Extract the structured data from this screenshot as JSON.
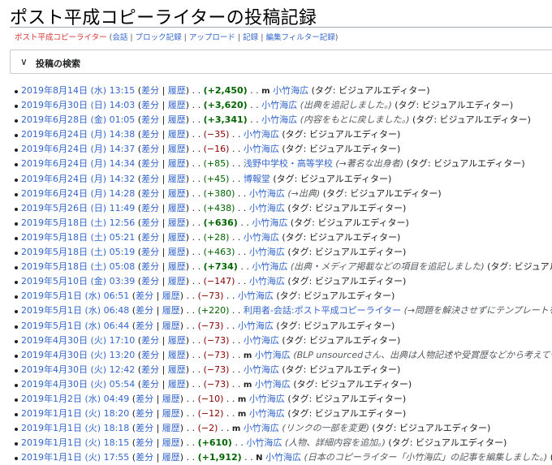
{
  "title": "ポスト平成コピーライターの投稿記録",
  "subtitle": {
    "user": "ポスト平成コピーライター",
    "links": [
      "会話",
      "ブロック記録",
      "アップロード",
      "記録",
      "編集フィルター記録"
    ]
  },
  "search": {
    "label": "投稿の検索",
    "chevron": "∨"
  },
  "labels": {
    "diff": "差分",
    "hist": "履歴",
    "tag_prefix": "タグ: ",
    "tag": "ビジュアルエディター"
  },
  "contribs": [
    {
      "date": "2019年8月14日 (水) 13:15",
      "size": "+2,450",
      "sizeClass": "posb",
      "flag": "m",
      "page": "小竹海広",
      "comment": "",
      "tag": "(タグ: ビジュアルエディター)"
    },
    {
      "date": "2019年6月30日 (日) 14:03",
      "size": "+3,620",
      "sizeClass": "posb",
      "flag": "",
      "page": "小竹海広",
      "comment": "(出典を追記しました。)",
      "tag": "(タグ: ビジュアルエディター)"
    },
    {
      "date": "2019年6月28日 (金) 01:05",
      "size": "+3,341",
      "sizeClass": "posb",
      "flag": "",
      "page": "小竹海広",
      "comment": "(内容をもとに戻しました。)",
      "tag": "(タグ: ビジュアルエディター)"
    },
    {
      "date": "2019年6月24日 (月) 14:38",
      "size": "−35",
      "sizeClass": "neg",
      "flag": "",
      "page": "小竹海広",
      "comment": "",
      "tag": "(タグ: ビジュアルエディター)"
    },
    {
      "date": "2019年6月24日 (月) 14:37",
      "size": "−16",
      "sizeClass": "neg",
      "flag": "",
      "page": "小竹海広",
      "comment": "",
      "tag": "(タグ: ビジュアルエディター)"
    },
    {
      "date": "2019年6月24日 (月) 14:34",
      "size": "+85",
      "sizeClass": "pos",
      "flag": "",
      "page": "浅野中学校・高等学校",
      "comment": "(→著名な出身者)",
      "tag": "(タグ: ビジュアルエディター)"
    },
    {
      "date": "2019年6月24日 (月) 14:32",
      "size": "+45",
      "sizeClass": "pos",
      "flag": "",
      "page": "博報堂",
      "comment": "",
      "tag": "(タグ: ビジュアルエディター)"
    },
    {
      "date": "2019年6月24日 (月) 14:28",
      "size": "+380",
      "sizeClass": "pos",
      "flag": "",
      "page": "小竹海広",
      "comment": "(→出典)",
      "tag": "(タグ: ビジュアルエディター)"
    },
    {
      "date": "2019年5月26日 (日) 11:49",
      "size": "+438",
      "sizeClass": "pos",
      "flag": "",
      "page": "小竹海広",
      "comment": "",
      "tag": "(タグ: ビジュアルエディター)"
    },
    {
      "date": "2019年5月18日 (土) 12:56",
      "size": "+636",
      "sizeClass": "posb",
      "flag": "",
      "page": "小竹海広",
      "comment": "",
      "tag": "(タグ: ビジュアルエディター)"
    },
    {
      "date": "2019年5月18日 (土) 05:21",
      "size": "+28",
      "sizeClass": "pos",
      "flag": "",
      "page": "小竹海広",
      "comment": "",
      "tag": "(タグ: ビジュアルエディター)"
    },
    {
      "date": "2019年5月18日 (土) 05:19",
      "size": "+463",
      "sizeClass": "pos",
      "flag": "",
      "page": "小竹海広",
      "comment": "",
      "tag": "(タグ: ビジュアルエディター)"
    },
    {
      "date": "2019年5月18日 (土) 05:08",
      "size": "+734",
      "sizeClass": "posb",
      "flag": "",
      "page": "小竹海広",
      "comment": "(出典・メディア掲載などの項目を追記しました)",
      "tag": "(タグ: ビジュアル"
    },
    {
      "date": "2019年5月10日 (金) 03:39",
      "size": "−147",
      "sizeClass": "neg",
      "flag": "",
      "page": "小竹海広",
      "comment": "",
      "tag": "(タグ: ビジュアルエディター)"
    },
    {
      "date": "2019年5月1日 (水) 06:51",
      "size": "−73",
      "sizeClass": "neg",
      "flag": "",
      "page": "小竹海広",
      "comment": "",
      "tag": "(タグ: ビジュアルエディター)"
    },
    {
      "date": "2019年5月1日 (水) 06:48",
      "size": "+220",
      "sizeClass": "pos",
      "flag": "",
      "page": "利用者‐会話:ポスト平成コピーライター",
      "comment": "(→問題を解決させずにテンプレートを",
      "tag": ""
    },
    {
      "date": "2019年5月1日 (水) 06:44",
      "size": "−73",
      "sizeClass": "neg",
      "flag": "",
      "page": "小竹海広",
      "comment": "",
      "tag": "(タグ: ビジュアルエディター)"
    },
    {
      "date": "2019年4月30日 (火) 17:10",
      "size": "−73",
      "sizeClass": "neg",
      "flag": "",
      "page": "小竹海広",
      "comment": "",
      "tag": "(タグ: ビジュアルエディター)"
    },
    {
      "date": "2019年4月30日 (火) 13:20",
      "size": "−73",
      "sizeClass": "neg",
      "flag": "m",
      "page": "小竹海広",
      "comment": "(BLP unsourcedさん、出典は人物記述や受賞歴などから考えて十",
      "tag": ""
    },
    {
      "date": "2019年4月30日 (火) 12:42",
      "size": "−73",
      "sizeClass": "neg",
      "flag": "",
      "page": "小竹海広",
      "comment": "",
      "tag": "(タグ: ビジュアルエディター)"
    },
    {
      "date": "2019年4月30日 (火) 05:54",
      "size": "−73",
      "sizeClass": "neg",
      "flag": "m",
      "page": "小竹海広",
      "comment": "",
      "tag": "(タグ: ビジュアルエディター)"
    },
    {
      "date": "2019年1月2日 (水) 04:49",
      "size": "−10",
      "sizeClass": "neg",
      "flag": "m",
      "page": "小竹海広",
      "comment": "",
      "tag": "(タグ: ビジュアルエディター)"
    },
    {
      "date": "2019年1月1日 (火) 18:20",
      "size": "−12",
      "sizeClass": "neg",
      "flag": "m",
      "page": "小竹海広",
      "comment": "",
      "tag": "(タグ: ビジュアルエディター)"
    },
    {
      "date": "2019年1月1日 (火) 18:18",
      "size": "−2",
      "sizeClass": "neg",
      "flag": "m",
      "page": "小竹海広",
      "comment": "(リンクの一部を変更)",
      "tag": "(タグ: ビジュアルエディター)"
    },
    {
      "date": "2019年1月1日 (火) 18:15",
      "size": "+610",
      "sizeClass": "posb",
      "flag": "",
      "page": "小竹海広",
      "comment": "(人物、詳細内容を追加。)",
      "tag": "(タグ: ビジュアルエディター)"
    },
    {
      "date": "2019年1月1日 (火) 17:55",
      "size": "+1,912",
      "sizeClass": "posb",
      "flag": "N",
      "page": "小竹海広",
      "comment": "(日本のコピーライター「小竹海広」の記事を編集しました。)",
      "tag": "(タ"
    }
  ]
}
